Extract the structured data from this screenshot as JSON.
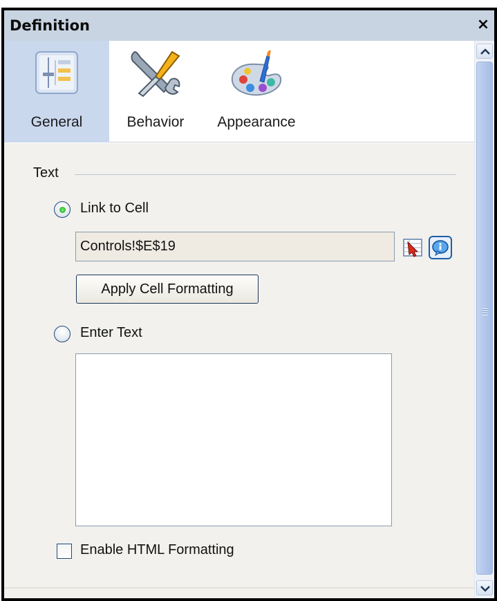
{
  "panel": {
    "title": "Definition",
    "close_symbol": "×"
  },
  "tabs": [
    {
      "label": "General",
      "icon": "general-properties-icon",
      "active": true
    },
    {
      "label": "Behavior",
      "icon": "wrench-screwdriver-icon",
      "active": false
    },
    {
      "label": "Appearance",
      "icon": "paint-palette-icon",
      "active": false
    }
  ],
  "general": {
    "section_label": "Text",
    "link_to_cell": {
      "label": "Link to Cell",
      "selected": true
    },
    "cell_reference": "Controls!$E$19",
    "apply_cell_formatting": "Apply Cell Formatting",
    "enter_text": {
      "label": "Enter Text",
      "selected": false,
      "value": ""
    },
    "enable_html_formatting": {
      "label": "Enable HTML Formatting",
      "checked": false
    }
  },
  "colors": {
    "title_bar": "#c9d4e2",
    "active_tab": "#cad8ee",
    "content_background": "#f2f1ed",
    "scrollbar_thumb": "#b3c7ec",
    "radio_selected": "#2fb52c"
  }
}
